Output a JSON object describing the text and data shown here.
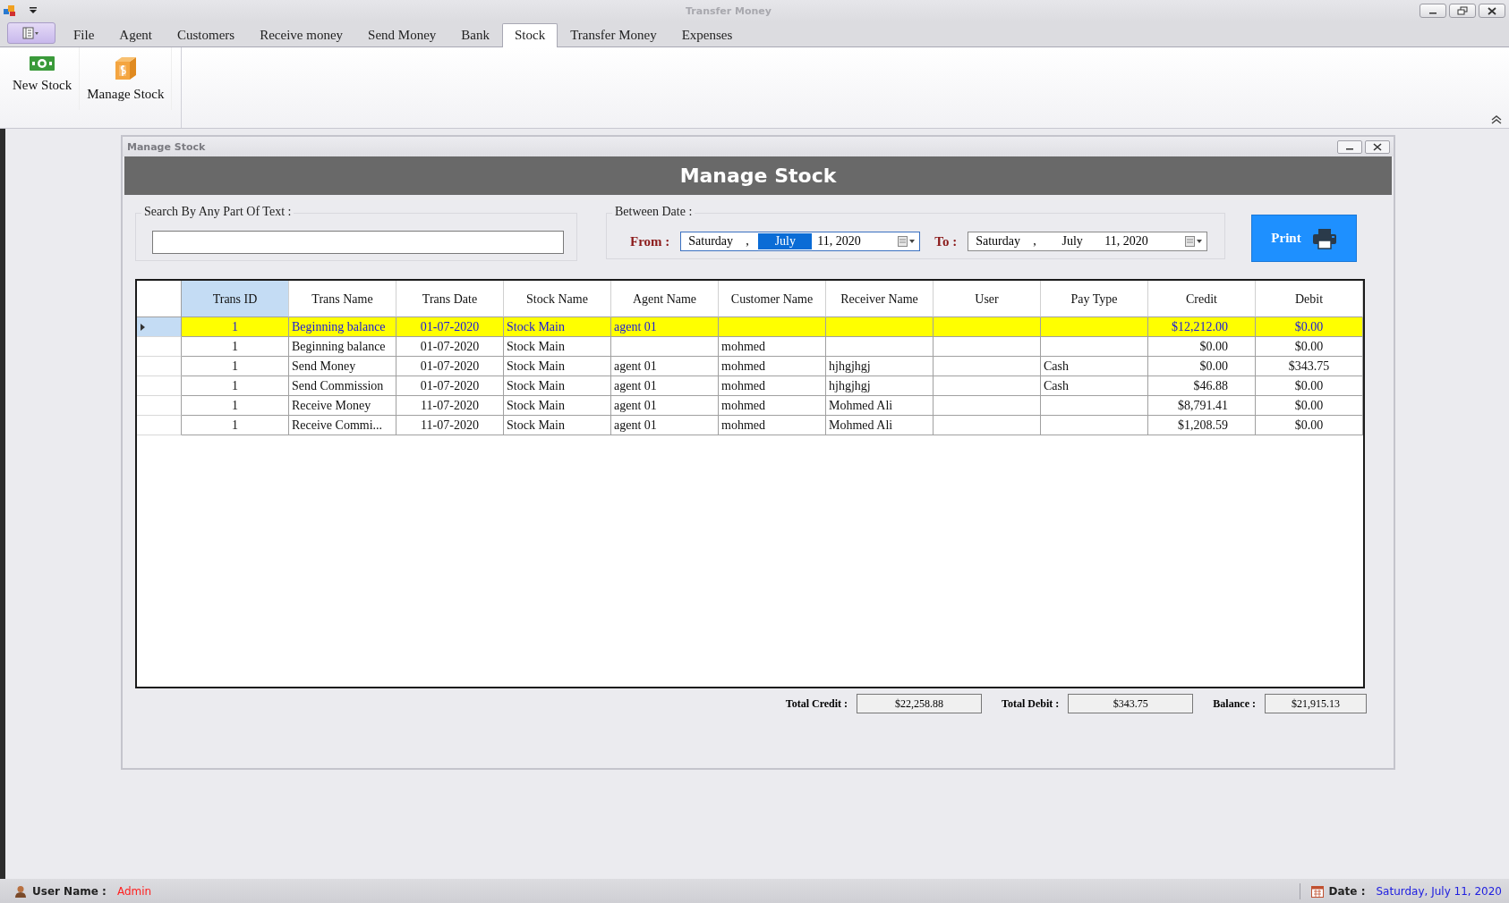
{
  "window": {
    "title": "Transfer Money"
  },
  "tabs": [
    {
      "label": "File",
      "selected": false
    },
    {
      "label": "Agent",
      "selected": false
    },
    {
      "label": "Customers",
      "selected": false
    },
    {
      "label": "Receive money",
      "selected": false
    },
    {
      "label": "Send Money",
      "selected": false
    },
    {
      "label": "Bank",
      "selected": false
    },
    {
      "label": "Stock",
      "selected": true
    },
    {
      "label": "Transfer Money",
      "selected": false
    },
    {
      "label": "Expenses",
      "selected": false
    }
  ],
  "ribbon": {
    "buttons": [
      {
        "label": "New Stock",
        "kind": "cash"
      },
      {
        "label": "Manage Stock",
        "kind": "box"
      }
    ]
  },
  "child_window": {
    "title": "Manage Stock",
    "header": "Manage Stock",
    "search": {
      "label": "Search By Any Part Of Text :"
    },
    "between_date": {
      "label": "Between Date :",
      "from": {
        "label": "From :",
        "weekday": "Saturday",
        "separator": ",",
        "month": "July",
        "day_year": "11, 2020",
        "month_selected": true
      },
      "to": {
        "label": "To :",
        "weekday": "Saturday",
        "separator": ",",
        "month": "July",
        "day_year": "11, 2020",
        "month_selected": false
      }
    },
    "print_button": "Print",
    "table": {
      "columns": [
        "Trans ID",
        "Trans Name",
        "Trans Date",
        "Stock Name",
        "Agent Name",
        "Customer Name",
        "Receiver Name",
        "User",
        "Pay Type",
        "Credit",
        "Debit"
      ],
      "rows": [
        {
          "selected": true,
          "cells": [
            "1",
            "Beginning balance",
            "01-07-2020",
            "Stock Main",
            "agent 01",
            "",
            "",
            "",
            "",
            "$12,212.00",
            "$0.00"
          ]
        },
        {
          "selected": false,
          "cells": [
            "1",
            "Beginning balance",
            "01-07-2020",
            "Stock Main",
            "",
            "mohmed",
            "",
            "",
            "",
            "$0.00",
            "$0.00"
          ]
        },
        {
          "selected": false,
          "cells": [
            "1",
            "Send Money",
            "01-07-2020",
            "Stock Main",
            "agent 01",
            "mohmed",
            "hjhgjhgj",
            "",
            "Cash",
            "$0.00",
            "$343.75"
          ]
        },
        {
          "selected": false,
          "cells": [
            "1",
            "Send Commission",
            "01-07-2020",
            "Stock Main",
            "agent 01",
            "mohmed",
            "hjhgjhgj",
            "",
            "Cash",
            "$46.88",
            "$0.00"
          ]
        },
        {
          "selected": false,
          "cells": [
            "1",
            "Receive Money",
            "11-07-2020",
            "Stock Main",
            "agent 01",
            "mohmed",
            "Mohmed Ali",
            "",
            "",
            "$8,791.41",
            "$0.00"
          ]
        },
        {
          "selected": false,
          "cells": [
            "1",
            "Receive Commi...",
            "11-07-2020",
            "Stock Main",
            "agent 01",
            "mohmed",
            "Mohmed Ali",
            "",
            "",
            "$1,208.59",
            "$0.00"
          ]
        }
      ]
    },
    "totals": [
      {
        "label": "Total Credit :",
        "value": "$22,258.88"
      },
      {
        "label": "Total Debit :",
        "value": "$343.75"
      },
      {
        "label": "Balance :",
        "value": "$21,915.13"
      }
    ]
  },
  "status_bar": {
    "user_label": "User Name :",
    "user": "Admin",
    "date_label": "Date :",
    "date": "Saturday, July 11, 2020"
  }
}
